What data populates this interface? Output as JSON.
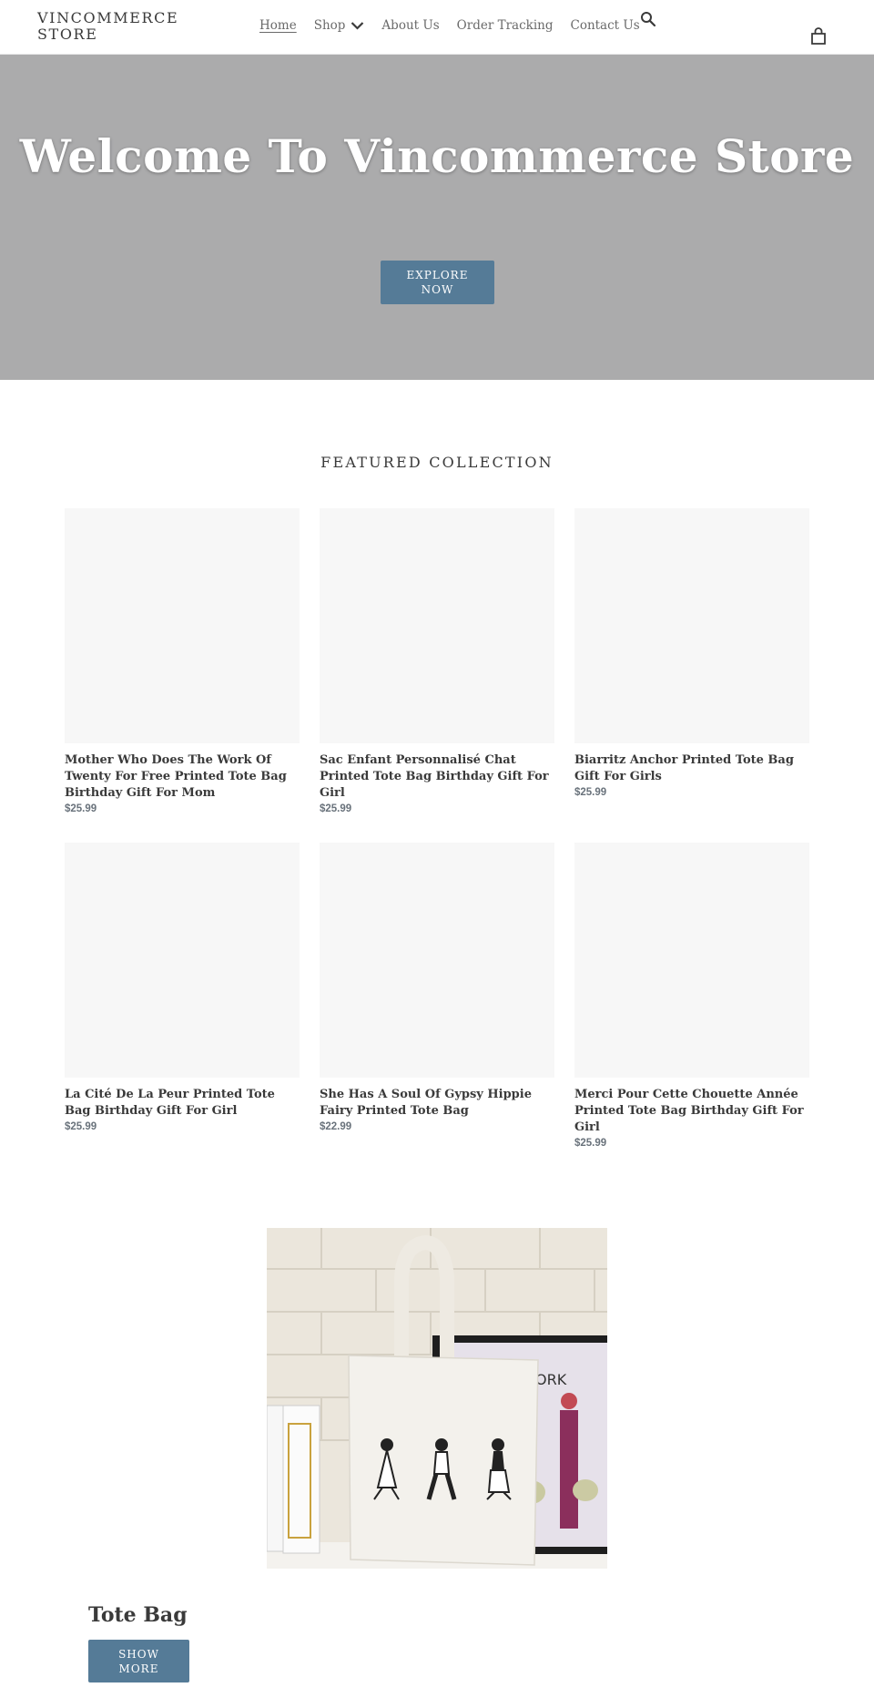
{
  "header": {
    "logo": "VINCOMMERCE STORE",
    "nav": [
      {
        "label": "Home",
        "active": true
      },
      {
        "label": "Shop",
        "has_dropdown": true
      },
      {
        "label": "About Us"
      },
      {
        "label": "Order Tracking"
      },
      {
        "label": "Contact Us"
      }
    ],
    "icons": {
      "search": "search-icon",
      "cart": "shopping-bag-icon",
      "dropdown": "chevron-down-icon"
    }
  },
  "hero": {
    "title": "Welcome To Vincommerce Store",
    "button_label": "EXPLORE NOW",
    "background_color": "#ababac"
  },
  "featured": {
    "title": "FEATURED COLLECTION",
    "products": [
      {
        "title": "Mother Who Does The Work Of Twenty For Free Printed Tote Bag Birthday Gift For Mom",
        "price": "$25.99"
      },
      {
        "title": "Sac Enfant Personnalisé Chat Printed Tote Bag Birthday Gift For Girl",
        "price": "$25.99"
      },
      {
        "title": "Biarritz Anchor Printed Tote Bag Gift For Girls",
        "price": "$25.99"
      },
      {
        "title": "La Cité De La Peur Printed Tote Bag Birthday Gift For Girl",
        "price": "$25.99"
      },
      {
        "title": "She Has A Soul Of Gypsy Hippie Fairy Printed Tote Bag",
        "price": "$22.99"
      },
      {
        "title": "Merci Pour Cette Chouette Année Printed Tote Bag Birthday Gift For Girl",
        "price": "$25.99"
      }
    ]
  },
  "collection_feature": {
    "title": "Tote Bag",
    "button_label": "SHOW MORE",
    "image_alt": "Canvas tote bag with three walking figures leaning against a brick wall"
  },
  "colors": {
    "accent": "#557b97",
    "text": "#3a3a3a",
    "price": "#69727b",
    "placeholder": "#f7f7f7"
  }
}
